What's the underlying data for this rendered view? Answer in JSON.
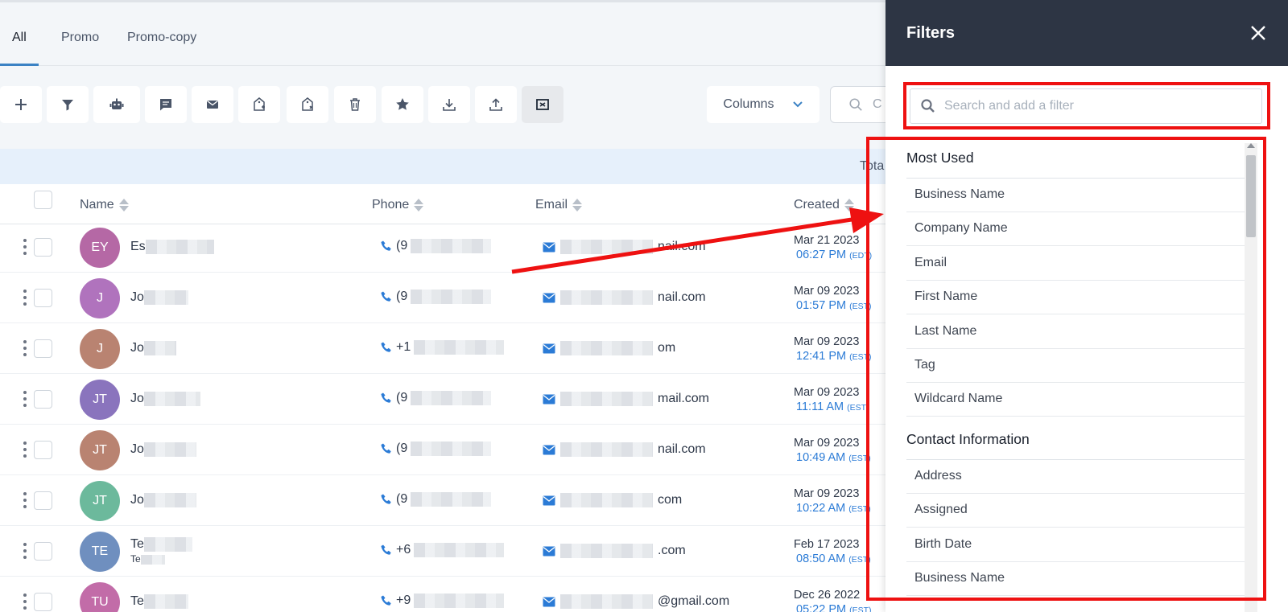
{
  "tabs": [
    {
      "label": "All",
      "active": true
    },
    {
      "label": "Promo",
      "active": false
    },
    {
      "label": "Promo-copy",
      "active": false
    }
  ],
  "toolbar": {
    "buttons": [
      "add-icon",
      "filter-icon",
      "robot-icon",
      "chat-icon",
      "mail-icon",
      "tag-add-icon",
      "tag-remove-icon",
      "trash-icon",
      "star-icon",
      "download-icon",
      "upload-icon",
      "merge-icon"
    ],
    "columns_label": "Columns",
    "search_partial": "C"
  },
  "total_bar": {
    "label": "Tota"
  },
  "table": {
    "headers": {
      "name": "Name",
      "phone": "Phone",
      "email": "Email",
      "created": "Created"
    },
    "rows": [
      {
        "initials": "EY",
        "color": "#b568a5",
        "name": "Es",
        "name_sub": "",
        "phone": "(9",
        "email": "nail.com",
        "date": "Mar 21 2023",
        "time": "06:27 PM",
        "tz": "(EDT)"
      },
      {
        "initials": "J",
        "color": "#b073bd",
        "name": "Jo",
        "name_sub": "",
        "phone": "(9",
        "email": "nail.com",
        "date": "Mar 09 2023",
        "time": "01:57 PM",
        "tz": "(EST)"
      },
      {
        "initials": "J",
        "color": "#b98371",
        "name": "Jo",
        "name_sub": "",
        "phone": "+1",
        "email": "om",
        "date": "Mar 09 2023",
        "time": "12:41 PM",
        "tz": "(EST)"
      },
      {
        "initials": "JT",
        "color": "#8a74bd",
        "name": "Jo",
        "name_sub": "",
        "phone": "(9",
        "email": "mail.com",
        "date": "Mar 09 2023",
        "time": "11:11 AM",
        "tz": "(EST)"
      },
      {
        "initials": "JT",
        "color": "#b98371",
        "name": "Jo",
        "name_sub": "",
        "phone": "(9",
        "email": "nail.com",
        "date": "Mar 09 2023",
        "time": "10:49 AM",
        "tz": "(EST)"
      },
      {
        "initials": "JT",
        "color": "#6cb99c",
        "name": "Jo",
        "name_sub": "",
        "phone": "(9",
        "email": "com",
        "date": "Mar 09 2023",
        "time": "10:22 AM",
        "tz": "(EST)"
      },
      {
        "initials": "TE",
        "color": "#6f8fbf",
        "name": "Te",
        "name_sub": "Te",
        "phone": "+6",
        "email": ".com",
        "date": "Feb 17 2023",
        "time": "08:50 AM",
        "tz": "(EST)"
      },
      {
        "initials": "TU",
        "color": "#c26ca8",
        "name": "Te",
        "name_sub": "",
        "phone": "+9",
        "email": "@gmail.com",
        "date": "Dec 26 2022",
        "time": "05:22 PM",
        "tz": "(EST)"
      }
    ]
  },
  "filters": {
    "title": "Filters",
    "search_placeholder": "Search and add a filter",
    "sections": [
      {
        "title": "Most Used",
        "items": [
          "Business Name",
          "Company Name",
          "Email",
          "First Name",
          "Last Name",
          "Tag",
          "Wildcard Name"
        ]
      },
      {
        "title": "Contact Information",
        "items": [
          "Address",
          "Assigned",
          "Birth Date",
          "Business Name"
        ]
      }
    ]
  },
  "colors": {
    "highlight": "#ee1111",
    "header_bg": "#2d3544",
    "accent": "#2b7bd6"
  }
}
